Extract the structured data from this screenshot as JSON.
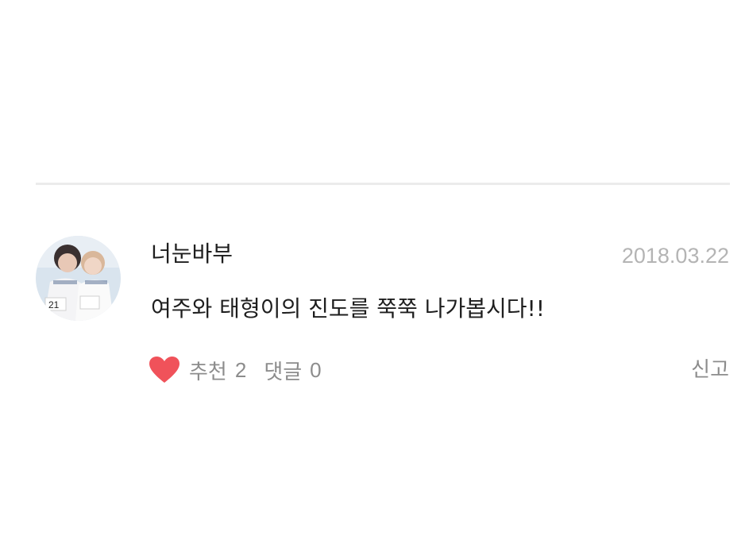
{
  "comment": {
    "author": "너눈바부",
    "date": "2018.03.22",
    "text": "여주와 태형이의 진도를 쭉쭉 나가봅시다!!",
    "avatar_icon": "user-photo-avatar"
  },
  "actions": {
    "like_icon": "heart-icon",
    "like_color": "#f0525a",
    "like_label": "추천",
    "like_count": "2",
    "reply_label": "댓글",
    "reply_count": "0",
    "report_label": "신고"
  },
  "colors": {
    "author_text": "#1e1e1e",
    "meta_text": "#8c8c8c",
    "date_text": "#b4b4b4",
    "divider": "#ebebeb"
  }
}
